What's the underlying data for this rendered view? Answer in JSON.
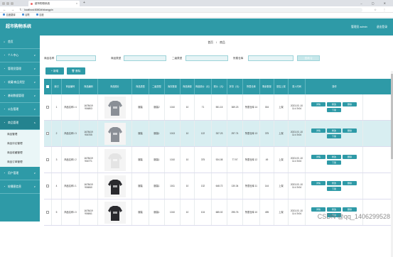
{
  "browser": {
    "tab_title": "超市购物系统",
    "tab_close": "×",
    "new_tab": "+",
    "url": "localhost:8080/#/shangpin",
    "bookmarks": [
      "百度翻译",
      "谷歌",
      "百度"
    ]
  },
  "header": {
    "title": "超市购物系统",
    "admin": "管理员 admin",
    "logout": "退出登录"
  },
  "sidebar": {
    "items": [
      {
        "label": "首页",
        "icon": "home-icon",
        "chevron": ""
      },
      {
        "label": "个人中心",
        "icon": "user-icon",
        "chevron": "∨"
      },
      {
        "label": "管理员管理",
        "icon": "admin-icon",
        "chevron": "∨"
      },
      {
        "label": "收藏/商品类型",
        "icon": "star-icon",
        "chevron": "∨"
      },
      {
        "label": "基础数据管理",
        "icon": "data-icon",
        "chevron": "∨"
      },
      {
        "label": "公告管理",
        "icon": "bell-icon",
        "chevron": "∨"
      },
      {
        "label": "商品管理",
        "icon": "goods-icon",
        "chevron": "∧"
      }
    ],
    "subitems": [
      "商品管理",
      "商品评论管理",
      "商品收藏管理",
      "商品订单管理"
    ],
    "items_after": [
      {
        "label": "用户管理",
        "icon": "users-icon",
        "chevron": "∨"
      },
      {
        "label": "轮播图信息",
        "icon": "image-icon",
        "chevron": "∨"
      }
    ]
  },
  "breadcrumb": {
    "home": "首页",
    "sep": "/",
    "current": "商品"
  },
  "search": {
    "name_label": "商品名称",
    "type_label": "商品类型",
    "subtype_label": "二级类型",
    "warehouse_label": "所属仓库",
    "button": "查询 Q"
  },
  "actions": {
    "add": "+ 新增",
    "delete": "🗑 删除"
  },
  "table": {
    "headers": [
      "索引",
      "商品编号",
      "商品照片",
      "商品类型",
      "二级类型",
      "库存数量",
      "商品销量",
      "商品原价（元）",
      "现价（元）",
      "折扣（元）",
      "所属仓库",
      "剩余数量",
      "是否上架",
      "录入时间",
      "操作"
    ],
    "rows": [
      {
        "idx": "1",
        "name": "商品名称1 4",
        "code": "1678419 904803",
        "type": "服装",
        "subtype": "服装2",
        "stock": "1010",
        "sales": "10",
        "count": "71",
        "price": "551.15",
        "now": "369.23",
        "warehouse": "所属仓库 14",
        "remain": "304",
        "shelf": "上架",
        "time": "2023-03 -10 11:4 5:04",
        "pic": "grey"
      },
      {
        "idx": "2",
        "name": "商品名称1 3",
        "code": "1678419 904705",
        "type": "服装",
        "subtype": "服装1",
        "stock": "1013",
        "sales": "10",
        "count": "122",
        "price": "337.23",
        "now": "297.74",
        "warehouse": "所属仓库 13",
        "remain": "375",
        "shelf": "上架",
        "time": "2023-03 -10 11:4 5:04",
        "pic": "grey"
      },
      {
        "idx": "3",
        "name": "商品名称1 2",
        "code": "1678419 904771",
        "type": "服装",
        "subtype": "服装1",
        "stock": "1010",
        "sales": "10",
        "count": "375",
        "price": "924.08",
        "now": "77.97",
        "warehouse": "所属仓库 12",
        "remain": "49",
        "shelf": "上架",
        "time": "2023-03 -10 11:4 5:04",
        "pic": "light"
      },
      {
        "idx": "4",
        "name": "商品名称1 1",
        "code": "1678419 904840",
        "type": "服装",
        "subtype": "服装1",
        "stock": "1011",
        "sales": "10",
        "count": "132",
        "price": "648.72",
        "now": "130.34",
        "warehouse": "所属仓库 11",
        "remain": "144",
        "shelf": "上架",
        "time": "2023-03 -10 11:4 5:04",
        "pic": "dark"
      },
      {
        "idx": "5",
        "name": "商品名称1 0",
        "code": "1678419 904841",
        "type": "服装",
        "subtype": "服装1",
        "stock": "1010",
        "sales": "10",
        "count": "104",
        "price": "685.02",
        "now": "295.76",
        "warehouse": "所属仓库 10",
        "remain": "495",
        "shelf": "上架",
        "time": "2023-03 -10 11:4 5:04",
        "pic": "dark"
      }
    ],
    "op_detail": "详情",
    "op_edit": "修改",
    "op_delete": "删除",
    "op_down": "下架"
  },
  "watermark": "CSDN @qq_1406299528",
  "colors": {
    "primary": "#2e9aa7",
    "alt_row": "#d8eef1"
  }
}
